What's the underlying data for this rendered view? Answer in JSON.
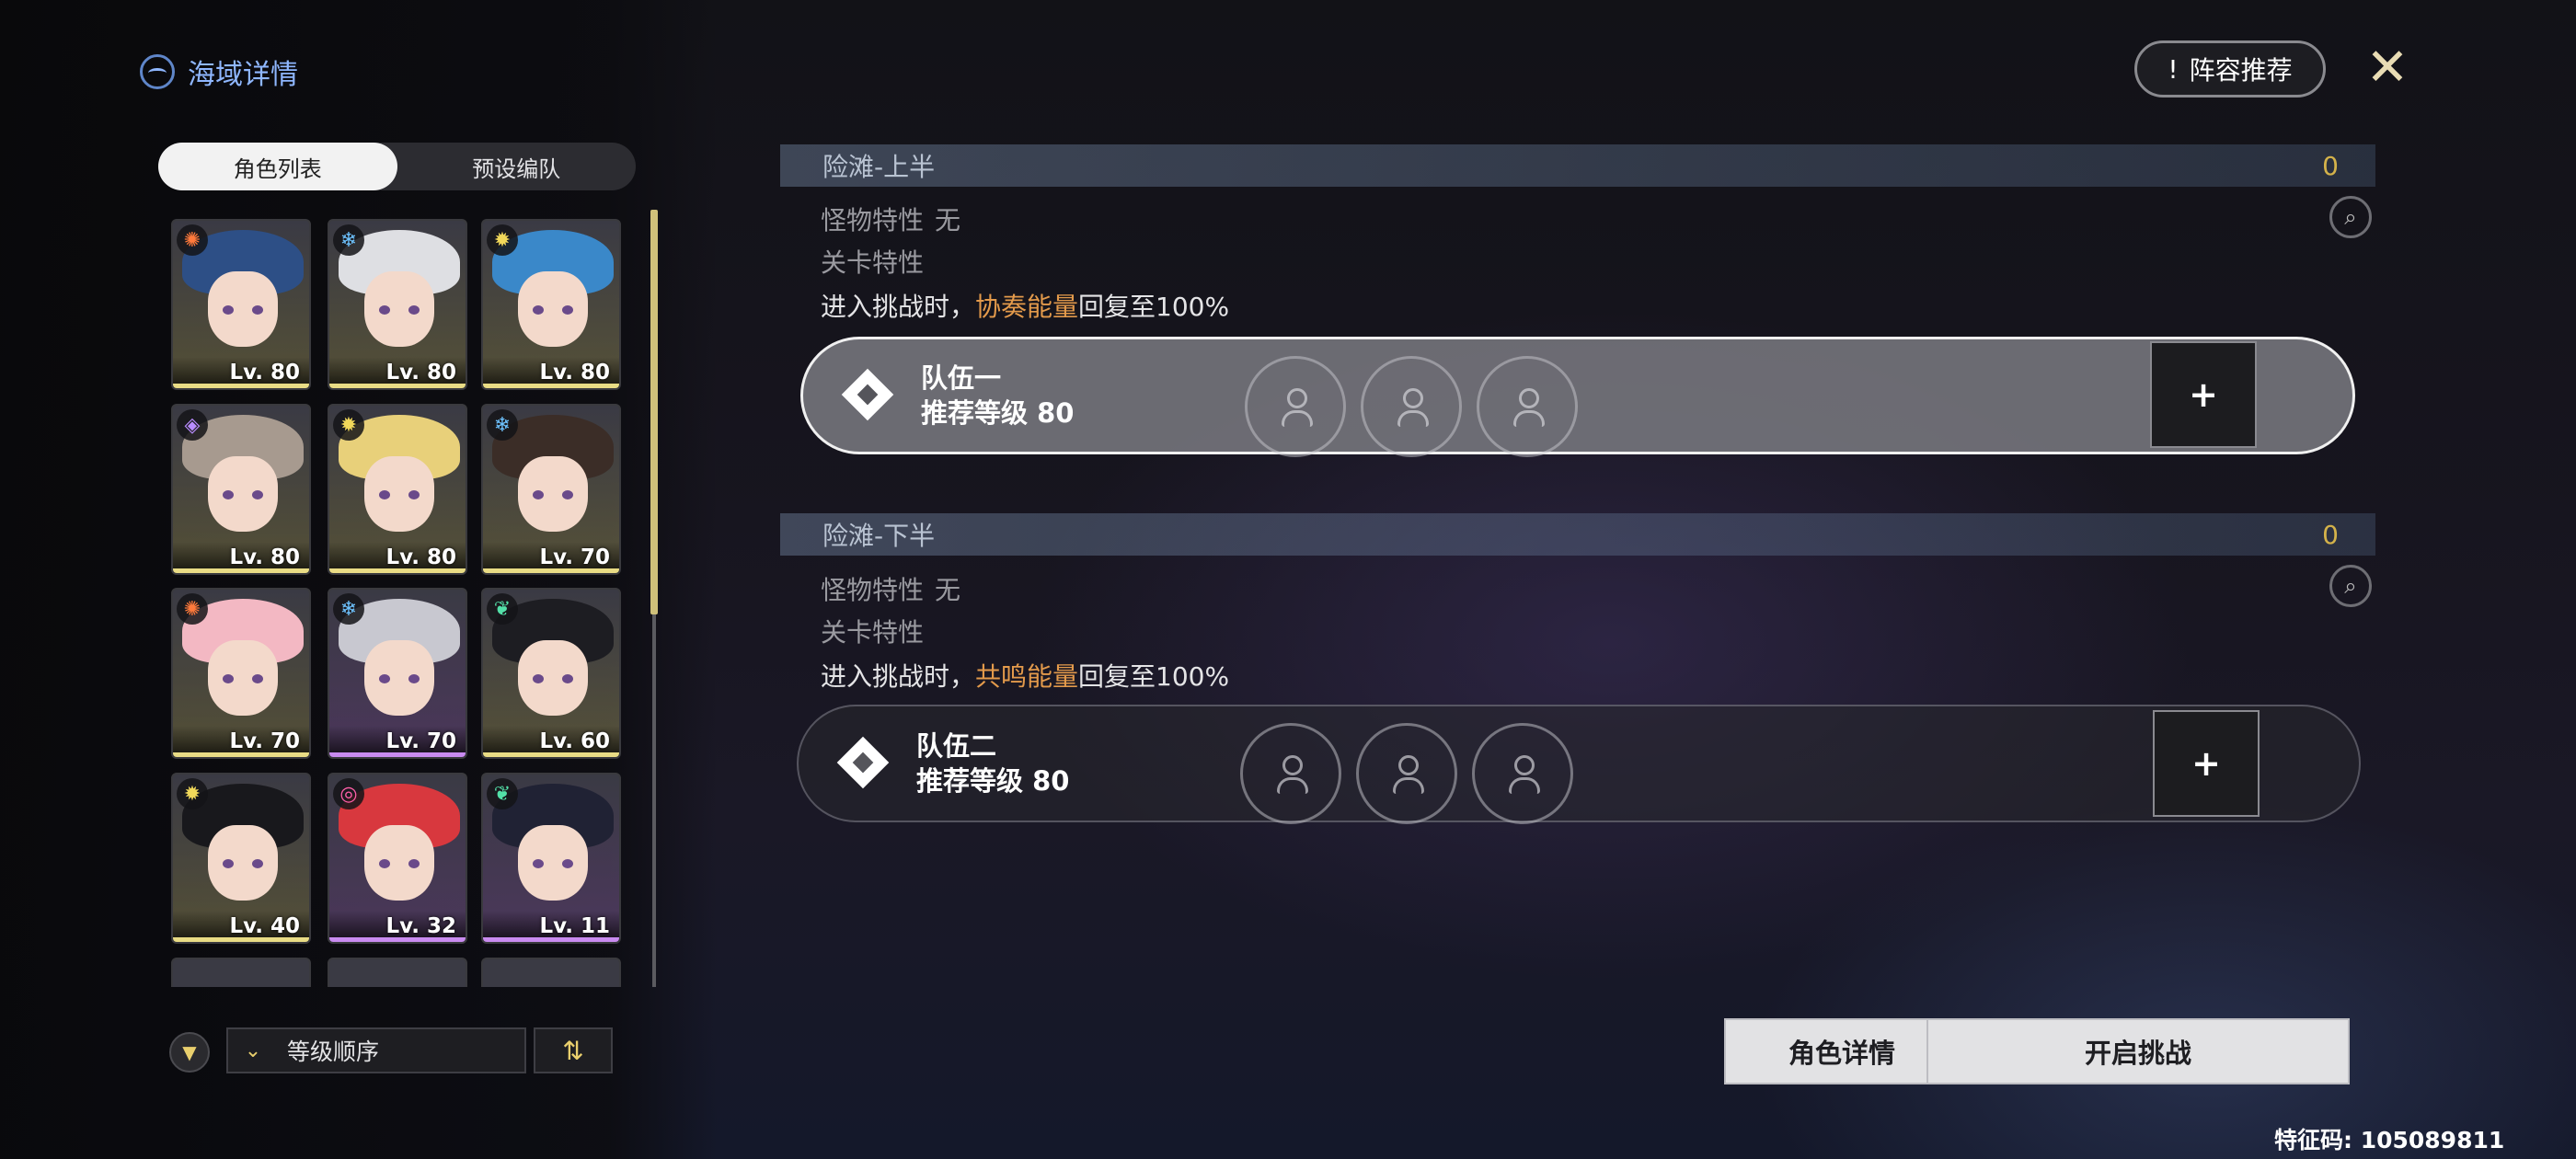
{
  "header": {
    "title": "海域详情",
    "recommend_mark": "!",
    "recommend_label": "阵容推荐"
  },
  "tabs": [
    {
      "label": "角色列表",
      "active": true
    },
    {
      "label": "预设编队",
      "active": false
    }
  ],
  "roster": [
    {
      "level": "Lv. 80",
      "element": "fusion-icon",
      "hair": "#2d4f86",
      "rarity": "#e9dc85"
    },
    {
      "level": "Lv. 80",
      "element": "glacio-icon",
      "hair": "#dedfe3",
      "rarity": "#e9dc85"
    },
    {
      "level": "Lv. 80",
      "element": "spectro-icon",
      "hair": "#3a88c9",
      "rarity": "#e9dc85"
    },
    {
      "level": "Lv. 80",
      "element": "electro-icon",
      "hair": "#a79a8f",
      "rarity": "#e9dc85"
    },
    {
      "level": "Lv. 80",
      "element": "spectro-icon",
      "hair": "#e8d07a",
      "rarity": "#e9dc85"
    },
    {
      "level": "Lv. 70",
      "element": "glacio-icon",
      "hair": "#3b2d27",
      "rarity": "#e9dc85"
    },
    {
      "level": "Lv. 70",
      "element": "fusion-icon",
      "hair": "#f3b8c3",
      "rarity": "#e9dc85"
    },
    {
      "level": "Lv. 70",
      "element": "glacio-icon",
      "hair": "#c8c8d0",
      "rarity": "#c98bf0"
    },
    {
      "level": "Lv. 60",
      "element": "aero-icon",
      "hair": "#1d1d22",
      "rarity": "#e9dc85"
    },
    {
      "level": "Lv. 40",
      "element": "spectro-icon",
      "hair": "#18181c",
      "rarity": "#e9dc85"
    },
    {
      "level": "Lv. 32",
      "element": "havoc-icon",
      "hair": "#d8383e",
      "rarity": "#c98bf0"
    },
    {
      "level": "Lv. 11",
      "element": "aero-icon",
      "hair": "#202234",
      "rarity": "#c98bf0"
    }
  ],
  "sort": {
    "filter_icon": "filter-icon",
    "label": "等级顺序",
    "order_icon": "sort-order-icon"
  },
  "sections": [
    {
      "title": "险滩-上半",
      "count": "0",
      "monster_label": "怪物特性",
      "monster_value": "无",
      "stage_label": "关卡特性",
      "effect_prefix": "进入挑战时，",
      "effect_highlight": "协奏能量",
      "effect_suffix": "回复至100%",
      "team_name": "队伍一",
      "team_level": "推荐等级 80",
      "add_label": "+"
    },
    {
      "title": "险滩-下半",
      "count": "0",
      "monster_label": "怪物特性",
      "monster_value": "无",
      "stage_label": "关卡特性",
      "effect_prefix": "进入挑战时，",
      "effect_highlight": "共鸣能量",
      "effect_suffix": "回复至100%",
      "team_name": "队伍二",
      "team_level": "推荐等级 80",
      "add_label": "+"
    }
  ],
  "buttons": {
    "character_detail": "角色详情",
    "start_challenge": "开启挑战"
  },
  "footer": {
    "code": "特征码: 105089811"
  },
  "colors": {
    "accent_gold": "#e9cf6d",
    "highlight_orange": "#e39a4b",
    "title_blue": "#8fb7ff"
  }
}
